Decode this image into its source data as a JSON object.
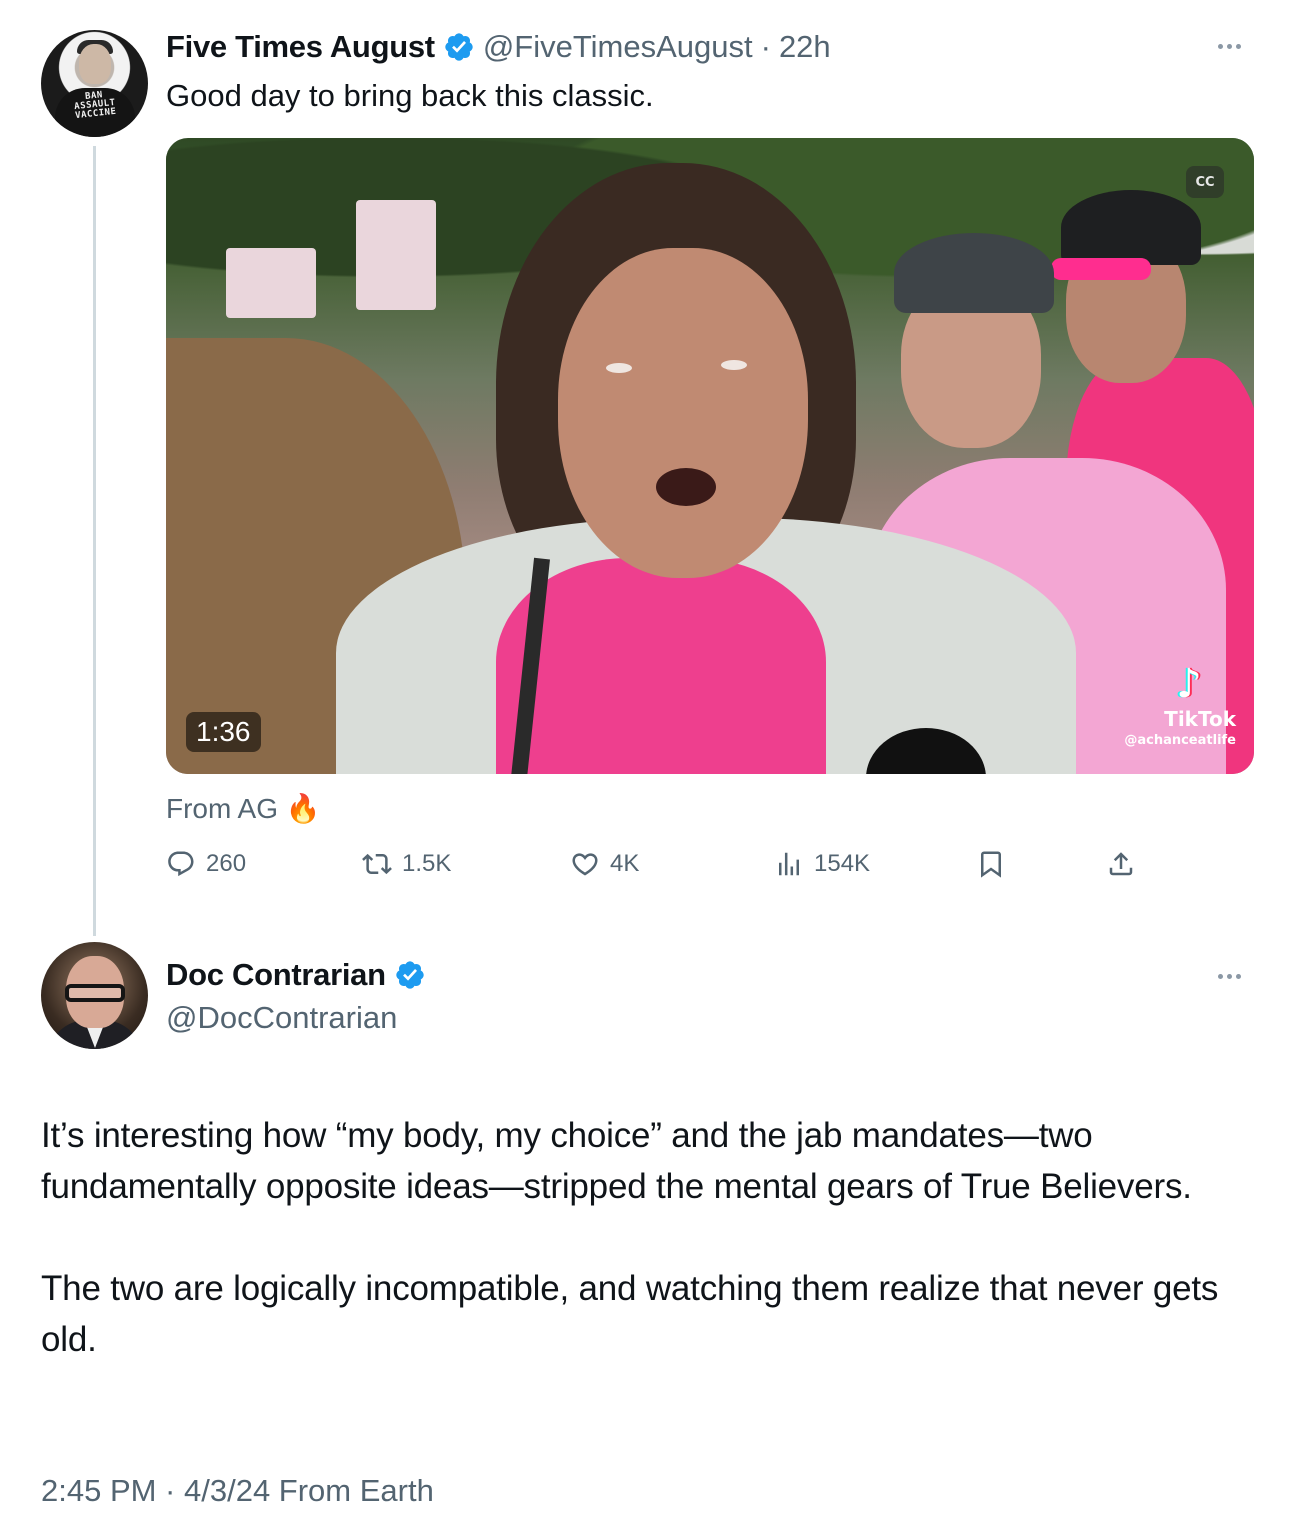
{
  "quoted_tweet": {
    "display_name": "Five Times August",
    "handle": "@FiveTimesAugust",
    "separator": "·",
    "time": "22h",
    "text": "Good day to bring back this classic.",
    "avatar_shirt_text": "BAN\nASSAULT\nVACCINE",
    "media": {
      "duration": "1:36",
      "captions_label": "CC",
      "watermark_brand": "TikTok",
      "watermark_user": "@achanceatlife"
    },
    "source_label": "From AG 🔥",
    "actions": {
      "replies": "260",
      "reposts": "1.5K",
      "likes": "4K",
      "views": "154K"
    }
  },
  "main_tweet": {
    "display_name": "Doc Contrarian",
    "handle": "@DocContrarian",
    "paragraphs": [
      "It’s interesting how “my body, my choice” and the jab mandates—two fundamentally opposite ideas—stripped the mental gears of True Believers.",
      "The two are logically incompatible, and watching them realize that never gets old."
    ],
    "timestamp": "2:45 PM · 4/3/24 From Earth"
  },
  "colors": {
    "verified_blue": "#1d9bf0",
    "secondary_text": "#536471",
    "thread_line": "#cfd9de"
  }
}
